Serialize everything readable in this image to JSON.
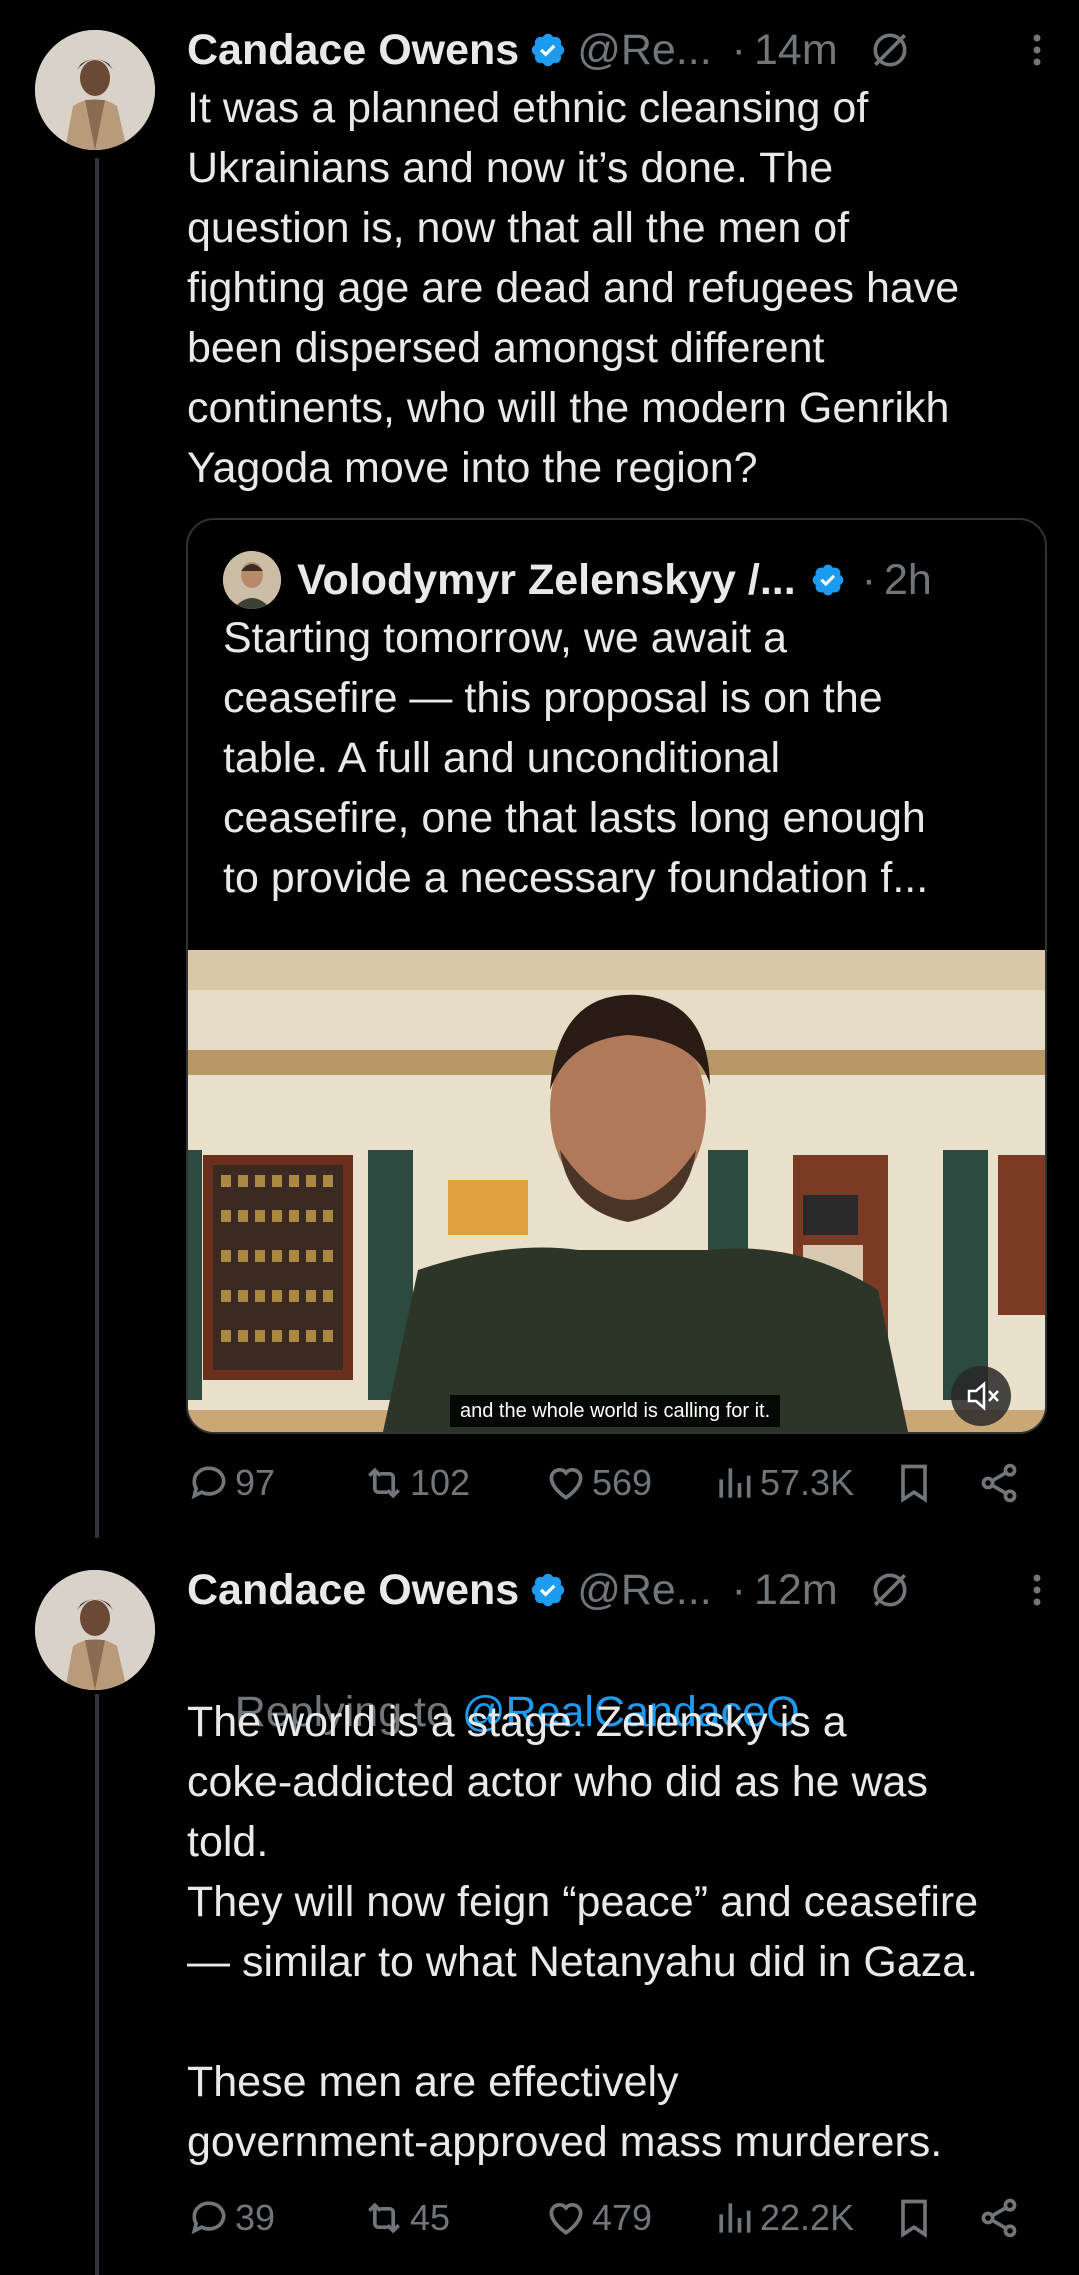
{
  "tweet1": {
    "name": "Candace Owens",
    "handle": "@Re...",
    "dot": "·",
    "time": "14m",
    "text": "It was a planned ethnic cleansing of\nUkrainians and now it’s done. The\nquestion is, now that all the men of\nfighting age are dead and refugees have\nbeen dispersed amongst different\ncontinents, who will the modern Genrikh\nYagoda move into the region?",
    "quote": {
      "name": "Volodymyr Zelenskyy /...",
      "dot": "·",
      "time": "2h",
      "text": "Starting tomorrow, we await a\nceasefire — this proposal is on the\ntable. A full and unconditional\nceasefire, one that lasts long enough\nto provide a necessary foundation f...",
      "video_caption": "and the whole world is calling for it."
    },
    "actions": {
      "replies": "97",
      "reposts": "102",
      "likes": "569",
      "views": "57.3K"
    }
  },
  "tweet2": {
    "name": "Candace Owens",
    "handle": "@Re...",
    "dot": "·",
    "time": "12m",
    "replying_prefix": "Replying to ",
    "replying_to": "@RealCandaceO",
    "text": "The world is a stage. Zelensky is a\ncoke-addicted actor who did as he was\ntold.\nThey will now feign “peace” and ceasefire\n— similar to what Netanyahu did in Gaza.\n\nThese men are effectively\ngovernment-approved mass murderers.",
    "actions": {
      "replies": "39",
      "reposts": "45",
      "likes": "479",
      "views": "22.2K"
    }
  },
  "colors": {
    "background": "#000000",
    "text": "#e7e9ea",
    "muted": "#71767b",
    "link": "#1d9bf0",
    "verified": "#1d9bf0"
  }
}
